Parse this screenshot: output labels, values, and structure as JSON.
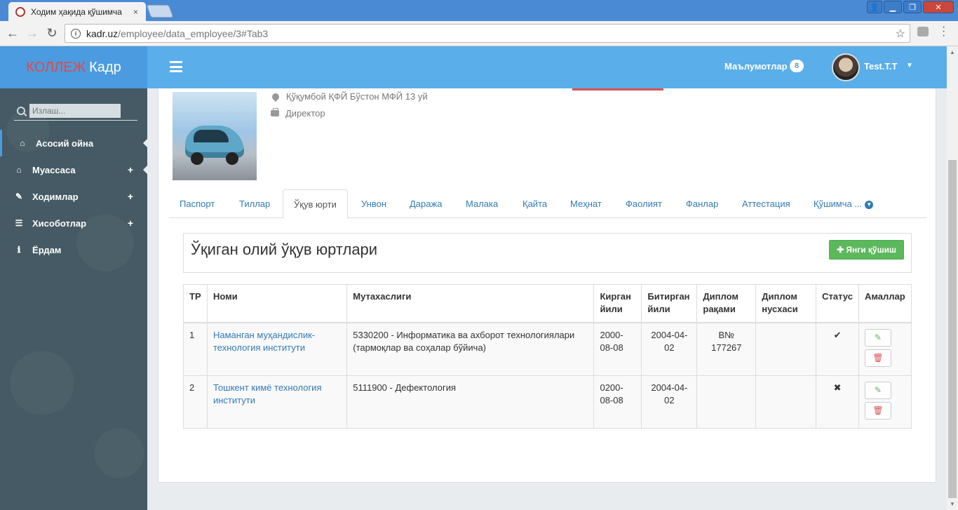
{
  "browser": {
    "tab_title": "Ходим ҳақида қўшимча",
    "tab_close": "×",
    "url_domain": "kadr.uz",
    "url_path": "/employee/data_employee/3#Tab3",
    "back": "←",
    "forward": "→",
    "reload": "↻",
    "star": "☆",
    "win_minimize": "▁",
    "win_maximize": "❐",
    "win_close": "✕",
    "win_user": "👤"
  },
  "header": {
    "logo_red": "КОЛЛЕЖ",
    "logo_white": "Кадр",
    "notifications_label": "Маълумотлар",
    "notifications_count": "8",
    "user_name": "Test.T.T",
    "user_caret": "▼"
  },
  "sidebar": {
    "search_placeholder": "Излаш...",
    "items": [
      {
        "label": "Асосий ойна",
        "icon": "home-icon",
        "glyph": "⌂"
      },
      {
        "label": "Муассаса",
        "icon": "home-icon",
        "glyph": "⌂",
        "expand": "+"
      },
      {
        "label": "Ходимлар",
        "icon": "edit-icon",
        "glyph": "✎",
        "expand": "+"
      },
      {
        "label": "Хисоботлар",
        "icon": "list-icon",
        "glyph": "☰",
        "expand": "+"
      },
      {
        "label": "Ёрдам",
        "icon": "info-icon",
        "glyph": "ℹ"
      }
    ]
  },
  "profile": {
    "address": "Қўқумбой ҚФЙ Бўстон МФЙ 13 уй",
    "position": "Директор"
  },
  "tabs": [
    {
      "label": "Паспорт"
    },
    {
      "label": "Тиллар"
    },
    {
      "label": "Ўқув юрти"
    },
    {
      "label": "Унвон"
    },
    {
      "label": "Даража"
    },
    {
      "label": "Малака"
    },
    {
      "label": "Қайта"
    },
    {
      "label": "Меҳнат"
    },
    {
      "label": "Фаолият"
    },
    {
      "label": "Фанлар"
    },
    {
      "label": "Аттестация"
    },
    {
      "label": "Қўшимча ..."
    }
  ],
  "section": {
    "title": "Ўқиган олий ўқув юртлари",
    "add_button": "Янги қўшиш",
    "add_glyph": "✚"
  },
  "table": {
    "headers": [
      "ТР",
      "Номи",
      "Мутахаслиги",
      "Кирган йили",
      "Битирган йили",
      "Диплом рақами",
      "Диплом нусхаси",
      "Статус",
      "Амаллар"
    ],
    "rows": [
      {
        "num": "1",
        "name": "Наманган муҳандислик-технология институти",
        "specialty": "5330200 - Информатика ва ахборот технологиялари (тармоқлар ва соҳалар бўйича)",
        "entered": "2000-08-08",
        "graduated": "2004-04-02",
        "diploma_no": "B№ 177267",
        "diploma_copy": "",
        "status": "✔"
      },
      {
        "num": "2",
        "name": "Тошкент кимё технология институти",
        "specialty": "5111900 - Дефектология",
        "entered": "0200-08-08",
        "graduated": "2004-04-02",
        "diploma_no": "",
        "diploma_copy": "",
        "status": "✖"
      }
    ],
    "edit_glyph": "✎",
    "delete_glyph": "🗑"
  }
}
